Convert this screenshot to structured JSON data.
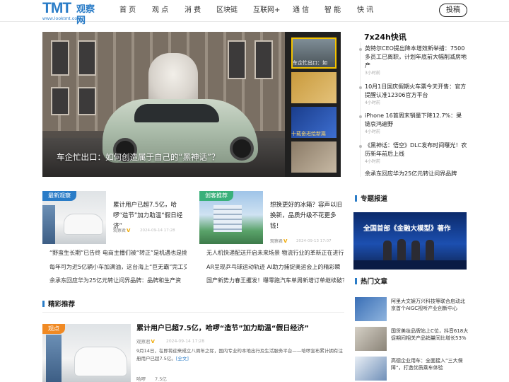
{
  "header": {
    "logo_text": "TMT",
    "logo_cn": "观察网",
    "logo_url": "www.looktmt.com",
    "nav": [
      "首 页",
      "观 点",
      "消 费",
      "区块链",
      "互联网+",
      "通 信",
      "智 能",
      "快 讯"
    ],
    "submit_label": "投稿"
  },
  "hero": {
    "caption": "车企忙出口：如何创造属于自己的“黑神话”？",
    "thumb_captions": [
      "车企忙出口：如",
      "",
      "十载奋进绘新篇",
      ""
    ]
  },
  "flash": {
    "title": "7x24h快讯",
    "items": [
      {
        "text": "英特尔CEO提出降本增效新举措：7500 多员工已离职，计划年底前大幅削减房地产",
        "time": "3小时前"
      },
      {
        "text": "10月1日国庆假期火车票今天开售：官方提醒认准12306官方平台",
        "time": "4小时前"
      },
      {
        "text": "iPhone 16首周末销量下降12.7%：果链哀鸿遍野",
        "time": "4小时前"
      },
      {
        "text": "《黑神话：悟空》DLC发布时间曝光！农历新年前后上线",
        "time": "4小时前"
      },
      {
        "text": "余承东回应华为25亿元转让问界品牌",
        "time": ""
      }
    ]
  },
  "cards": [
    {
      "tag": "最新观察",
      "tag_color": "#2a7cc7",
      "title": "累计用户已超7.5亿，哈啰“造节”加力助温“假日经济”",
      "author": "观察君",
      "date": "2024-09-14 17:28"
    },
    {
      "tag": "创客推荐",
      "tag_color": "#39b07a",
      "title": "想换更好的冰箱？容声以旧换新，品质升级不花更多钱！",
      "author": "观察君",
      "date": "2024-09-13 17:07"
    }
  ],
  "links_left": [
    "“野蛮生长期”已告终 电商主播们被“转正”是机遇也是挑",
    "每年可为近5亿辆小车加满油，这台海上“巨无霸”完工交",
    "余承东回应华为25亿元转让问界品牌：品牌和生产资"
  ],
  "links_mid": [
    "无人机快递配送开启未来场景 物流行业的革新正在进行",
    "AR呈现乒乓球运动轨迹 AI助力捕捉奥运会上的精彩瞬",
    "国产新势力春王攫发！曝零跑汽车单周新增订单继续破？"
  ],
  "topic": {
    "title": "专题报道",
    "banner_text": "全国首部《金融大模型》著作"
  },
  "hot": {
    "title": "热门文章",
    "items": [
      "阿里大文娱万兴科技等联合启动北京首个AIGC视听产业创新中心",
      "国货美妆品牌站上C位，抖音618大促期间相关产品销量同比增长53%",
      "高德企业用车：全面接入“三大保障”，打造优质乘车体验"
    ]
  },
  "featured": {
    "section_title": "精彩推荐",
    "tag": "观点",
    "title": "累计用户已超7.5亿，哈啰“造节”加力助温“假日经济”",
    "author": "观察君",
    "date": "2024-09-14 17:28",
    "summary": "9月14日，在即将迎来成立八周年之际，国内专业的本地出行及生活服务平台——哈啰宣布累计拥有注册用户已超7.5亿。",
    "full_link": "[全文]",
    "keywords": [
      "哈啰",
      "7.5亿"
    ]
  },
  "colors": {
    "brand": "#2a7cc7",
    "tag_green": "#39b07a",
    "tag_orange": "#f08a24"
  }
}
